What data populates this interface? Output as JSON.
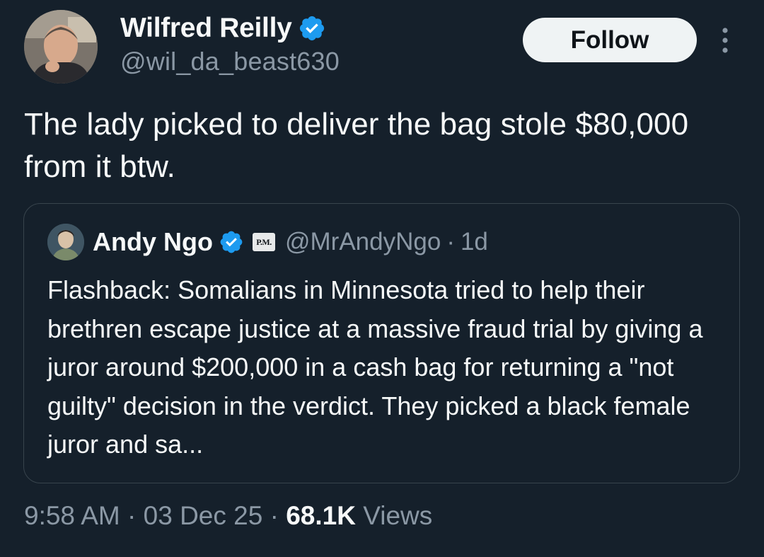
{
  "author": {
    "name": "Wilfred Reilly",
    "handle": "@wil_da_beast630"
  },
  "follow_label": "Follow",
  "tweet_text": "The lady picked to deliver the bag stole $80,000 from it btw.",
  "quote": {
    "name": "Andy Ngo",
    "affiliate_badge": "P.M.",
    "handle": "@MrAndyNgo",
    "separator": "·",
    "time": "1d",
    "text": "Flashback: Somalians in Minnesota tried to help their brethren escape justice at a massive fraud trial by giving a juror around $200,000 in a cash bag for returning a \"not guilty\" decision in the verdict. They picked a black female juror and sa..."
  },
  "meta": {
    "time": "9:58 AM",
    "sep1": " · ",
    "date": "03 Dec 25",
    "sep2": " · ",
    "views_count": "68.1K",
    "views_label": " Views"
  },
  "colors": {
    "background": "#15202b",
    "verified": "#1d9bf0",
    "secondary_text": "#8b98a5",
    "border": "#38444d"
  },
  "icons": {
    "verified": "verified-badge-icon",
    "more": "more-vertical-icon"
  }
}
